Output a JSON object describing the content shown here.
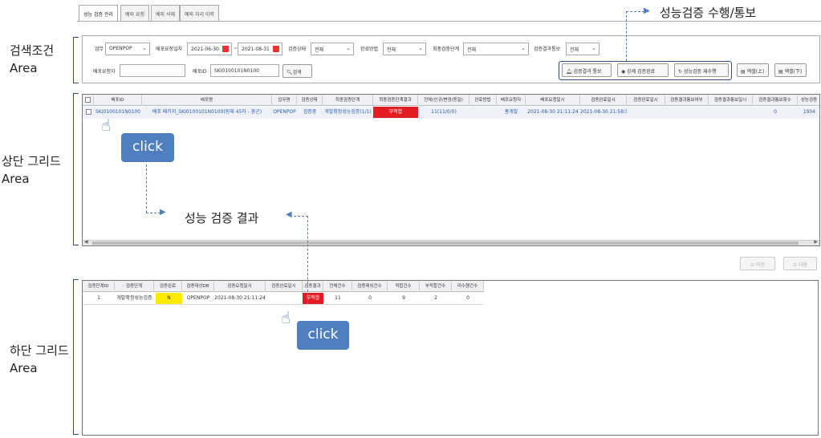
{
  "tabs": [
    "성능 검증 관리",
    "예외 요청",
    "예외 삭제",
    "예외 처리 이력"
  ],
  "area_labels": {
    "search": [
      "검색조건",
      "Area"
    ],
    "upper": [
      "상단 그리드",
      "Area"
    ],
    "lower": [
      "하단 그리드",
      "Area"
    ]
  },
  "search": {
    "row1": {
      "biz_label": "업무",
      "biz_value": "OPENPOP",
      "date_label": "배포요청일자",
      "date_from": "2021-06-30",
      "date_sep": "~",
      "date_to": "2021-08-31",
      "status_label": "검증상태",
      "status_value": "전체",
      "method_label": "완료방법",
      "method_value": "전체",
      "final_stage_label": "최종검증단계",
      "final_stage_value": "전체",
      "notify_label": "검증결과통보",
      "notify_value": "전체"
    },
    "row2": {
      "requester_label": "배포요청자",
      "requester_value": "",
      "deploy_id_label": "배포ID",
      "deploy_id_value": "SKI0100101N0100",
      "search_button": "검색"
    },
    "actions": {
      "notify_result": "검증결과 통보",
      "force_complete": "강제 검증완료",
      "rerun": "성능검증 재수행",
      "excel_up": "엑셀(上)",
      "excel_down": "엑셀(下)"
    }
  },
  "upper_grid": {
    "headers": [
      "배포ID",
      "배포명",
      "업무명",
      "검증상태",
      "최종검증단계",
      "최종검증단계결과",
      "전체(신규/변경/동일)",
      "완료방법",
      "배포요청자",
      "배포요청일시",
      "검증완료일시",
      "검증완료일시",
      "검증결과통보여부",
      "검증결과통보일시",
      "검증결과통보횟수",
      "성능검증"
    ],
    "row": {
      "deploy_id": "SKI0100101N0100",
      "deploy_name": "배포 패키지_SKI0100101N0100(원재 45차 - 광군)",
      "biz": "OPENPOP",
      "status": "검증중",
      "final_stage": "개발확정성능검증(1/1)",
      "final_result": "부적합",
      "counts": "11(11/0/0)",
      "method": "",
      "requester": "홍개발",
      "request_time": "2021-08-30 21:11:24",
      "complete_time": "2021-08-30 21:58:52",
      "complete_time2": "",
      "notify_yn": "",
      "notify_time": "",
      "notify_count": "0",
      "perf": "1904"
    }
  },
  "pager": {
    "prev": "이전",
    "next": "다음"
  },
  "lower_grid": {
    "headers": [
      "검증단계ID",
      "검증단계",
      "검증완료",
      "검증대상DB",
      "검증요청일시",
      "검증완료일시",
      "검증결과",
      "전체건수",
      "검증제외건수",
      "적합건수",
      "부적합건수",
      "미수행건수"
    ],
    "row": {
      "stage_id": "1",
      "stage": "개발확정성능검증",
      "done": "N",
      "db": "OPENPOP",
      "request_time": "2021-08-30 21:11:24",
      "complete_time": "",
      "result": "부적합",
      "total": "11",
      "excluded": "0",
      "fit": "9",
      "unfit": "2",
      "not_run": "0"
    }
  },
  "annotations": {
    "click": "click",
    "top_callout": "성능검증 수행/통보",
    "mid_callout": "성능 검증 결과"
  },
  "colors": {
    "accent": "#4f7fbf",
    "bracket": "#2b4e8f",
    "fail": "#e21d24",
    "warn": "#ffea00"
  }
}
